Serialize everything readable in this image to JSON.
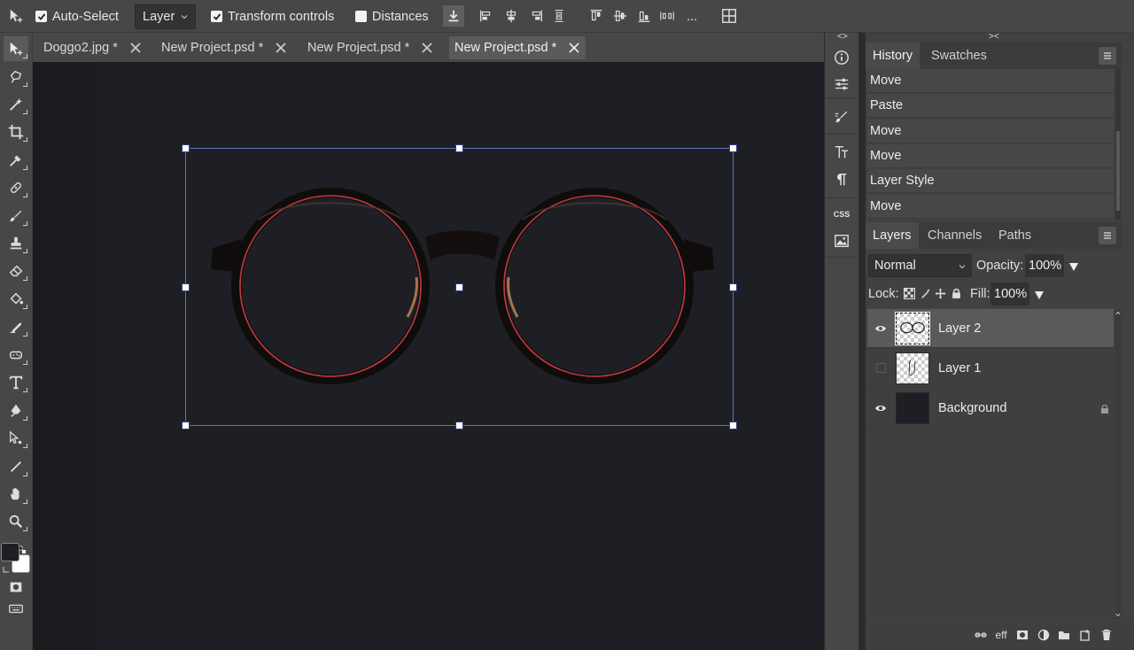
{
  "options_bar": {
    "auto_select_label": "Auto-Select",
    "auto_select_checked": true,
    "layer_dropdown_value": "Layer",
    "transform_controls_label": "Transform controls",
    "transform_controls_checked": true,
    "distances_label": "Distances",
    "distances_checked": false,
    "more_label": "..."
  },
  "doc_tabs": [
    {
      "name": "Doggo2.jpg *",
      "active": false
    },
    {
      "name": "New Project.psd *",
      "active": false
    },
    {
      "name": "New Project.psd *",
      "active": false
    },
    {
      "name": "New Project.psd *",
      "active": true
    }
  ],
  "side_icons": {
    "collapse_left": "<>",
    "collapse_right": "><",
    "css_label": "CSS"
  },
  "history_panel": {
    "tabs": [
      "History",
      "Swatches"
    ],
    "active_tab": "History",
    "items": [
      "Move",
      "Paste",
      "Move",
      "Move",
      "Layer Style",
      "Move"
    ]
  },
  "layers_panel": {
    "tabs": [
      "Layers",
      "Channels",
      "Paths"
    ],
    "active_tab": "Layers",
    "blend_mode": "Normal",
    "opacity_label": "Opacity:",
    "opacity_value": "100%",
    "lock_label": "Lock:",
    "fill_label": "Fill:",
    "fill_value": "100%",
    "layers": [
      {
        "name": "Layer 2",
        "visible": true,
        "selected": true
      },
      {
        "name": "Layer 1",
        "visible": false,
        "selected": false
      },
      {
        "name": "Background",
        "visible": true,
        "selected": false,
        "locked": true
      }
    ],
    "footer_eff_label": "eff"
  },
  "colors": {
    "foreground": "#1e1f24",
    "background": "#ffffff",
    "selection_border": "#5a73c8",
    "canvas_bg": "#1e1f24"
  }
}
